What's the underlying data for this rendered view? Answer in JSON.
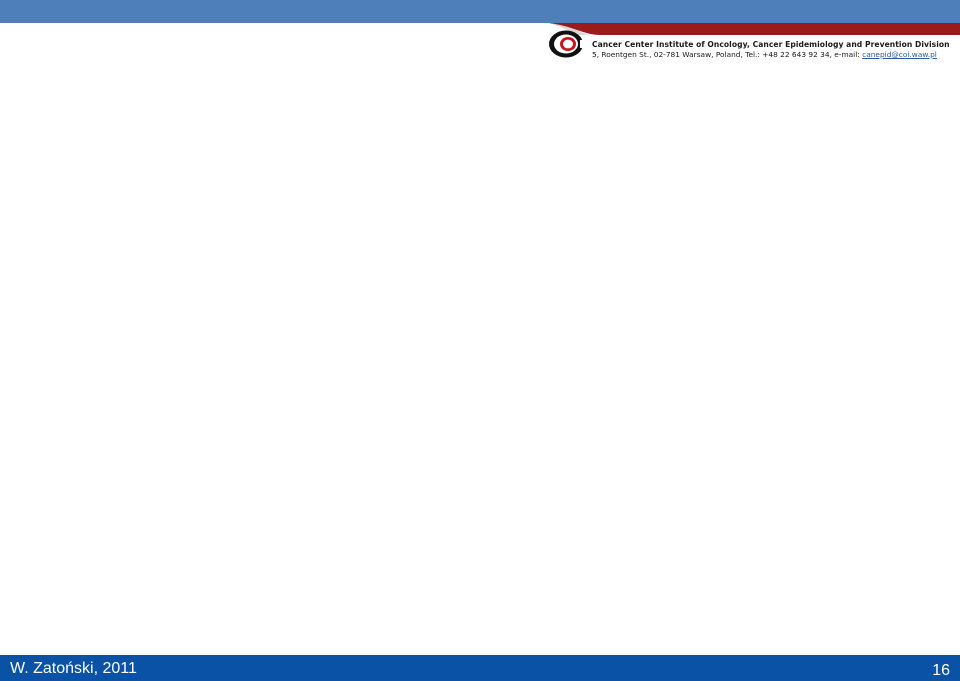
{
  "header": {
    "institution_line": "Cancer Center Institute of Oncology, Cancer Epidemiology and Prevention Division",
    "address_prefix": "5, Roentgen St., 02-781 Warsaw, Poland, Tel.: +48 22 643 92 34, e-mail: ",
    "email": "canepid@coi.waw.pl"
  },
  "footer": {
    "author": "W. Zatoński, 2011",
    "page_number": "16"
  },
  "colors": {
    "top_band": "#4f7fba",
    "accent_red": "#9b1b1b",
    "footer_band": "#0a52a6"
  }
}
